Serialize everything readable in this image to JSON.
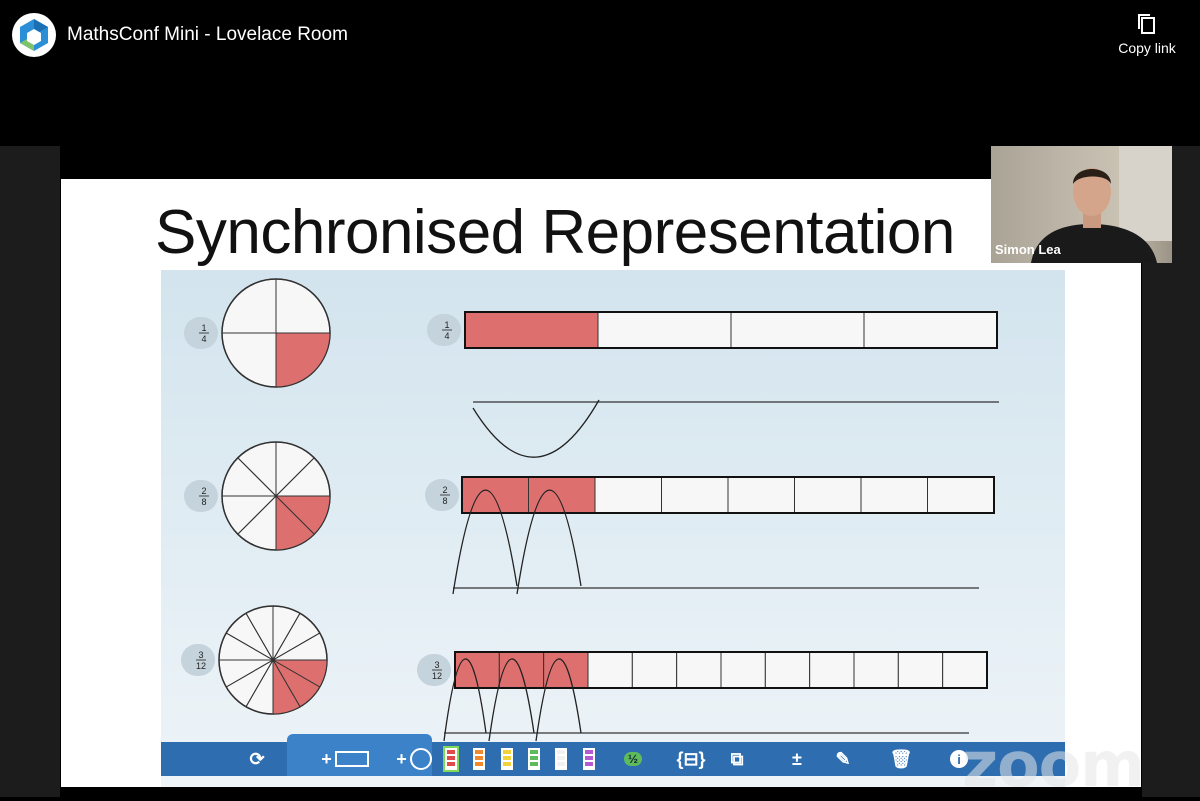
{
  "window": {
    "title": "MathsConf Mini - Lovelace Room",
    "copy_link_label": "Copy link"
  },
  "slide": {
    "title": "Synchronised Representation",
    "rows": [
      {
        "fraction_label": "1/4",
        "numerator": "1",
        "denominator": "4",
        "parts": 4,
        "shaded": 1
      },
      {
        "fraction_label": "2/8",
        "numerator": "2",
        "denominator": "8",
        "parts": 8,
        "shaded": 2
      },
      {
        "fraction_label": "3/12",
        "numerator": "3",
        "denominator": "12",
        "parts": 12,
        "shaded": 3
      }
    ],
    "colors": {
      "shaded": "#de6f6f",
      "unshaded": "#f7f7f7",
      "panel": "#dce9f1",
      "toolbar": "#2e6eb0"
    }
  },
  "toolbar": {
    "items": [
      {
        "name": "refresh-icon",
        "glyph": "⟳"
      },
      {
        "name": "add-bar-icon",
        "glyph": "+"
      },
      {
        "name": "add-circle-icon",
        "glyph": "+"
      },
      {
        "name": "bar-red-icon",
        "glyph": ""
      },
      {
        "name": "bar-orange-icon",
        "glyph": ""
      },
      {
        "name": "bar-yellow-icon",
        "glyph": ""
      },
      {
        "name": "bar-green-icon",
        "glyph": ""
      },
      {
        "name": "bar-white-icon",
        "glyph": ""
      },
      {
        "name": "bar-purple-icon",
        "glyph": ""
      },
      {
        "name": "fraction-icon",
        "glyph": "½"
      },
      {
        "name": "split-icon",
        "glyph": "{⊟}"
      },
      {
        "name": "compare-icon",
        "glyph": "⧉"
      },
      {
        "name": "operations-icon",
        "glyph": "±"
      },
      {
        "name": "pen-icon",
        "glyph": "✎"
      },
      {
        "name": "trash-icon",
        "glyph": "🗑"
      },
      {
        "name": "info-icon",
        "glyph": "i"
      }
    ]
  },
  "watermark": "zoom",
  "participant": {
    "name": "Simon Lea"
  }
}
